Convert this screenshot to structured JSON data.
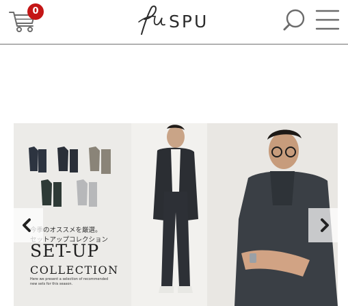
{
  "header": {
    "cart_count": "0",
    "logo_text": "SPU"
  },
  "banner": {
    "jp_copy": "今季のオススメを厳選。\nセットアップコレクション",
    "title": "SET-UP",
    "subtitle": "COLLECTION",
    "small_copy": "Here we present a selection of recommended\nnew sets for this season."
  },
  "colors": {
    "badge": "#c41616",
    "text": "#2b2b2b",
    "divider": "#6f6f6f"
  },
  "icons": {
    "cart": "shopping-cart-icon",
    "search": "search-icon",
    "menu": "hamburger-menu-icon",
    "prev": "chevron-left-icon",
    "next": "chevron-right-icon"
  }
}
